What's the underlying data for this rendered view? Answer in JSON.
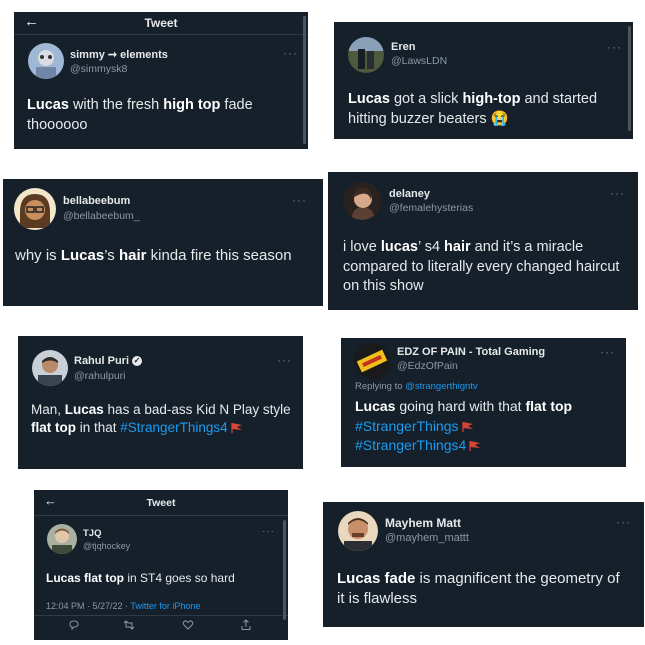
{
  "tweets": [
    {
      "header_title": "Tweet",
      "name": "simmy ➞ elements",
      "handle": "@simmysk8",
      "text": [
        [
          "Lucas",
          "hl"
        ],
        [
          " with the fresh ",
          ""
        ],
        [
          "high top",
          "hl"
        ],
        [
          " fade thoooooo",
          ""
        ]
      ]
    },
    {
      "name": "Eren",
      "handle": "@LawsLDN",
      "text": [
        [
          "Lucas",
          "hl"
        ],
        [
          " got a slick ",
          ""
        ],
        [
          "high-top",
          "hl"
        ],
        [
          " and started hitting buzzer beaters 😭",
          ""
        ]
      ]
    },
    {
      "name": "bellabeebum",
      "handle": "@bellabeebum_",
      "text": [
        [
          "why is ",
          ""
        ],
        [
          "Lucas",
          "hl"
        ],
        [
          "’s ",
          ""
        ],
        [
          "hair",
          "hl"
        ],
        [
          " kinda fire this season",
          ""
        ]
      ]
    },
    {
      "name": "delaney",
      "handle": "@femalehysterias",
      "text": [
        [
          "i love ",
          ""
        ],
        [
          "lucas",
          "hl"
        ],
        [
          "’ s4 ",
          ""
        ],
        [
          "hair",
          "hl"
        ],
        [
          " and it’s a miracle compared to literally every changed haircut on this show",
          ""
        ]
      ]
    },
    {
      "name": "Rahul Puri",
      "handle": "@rahulpuri",
      "text": [
        [
          "Man, ",
          ""
        ],
        [
          "Lucas",
          "hl"
        ],
        [
          " has a bad-ass Kid N Play style ",
          ""
        ],
        [
          "flat top",
          "hl"
        ],
        [
          " in that ",
          ""
        ],
        [
          "#StrangerThings4",
          "tag"
        ]
      ]
    },
    {
      "name": "EDZ OF PAIN - Total Gaming",
      "handle": "@EdzOfPain",
      "reply_prefix": "Replying to ",
      "reply_to": "@strangerthigntv",
      "text": [
        [
          "Lucas",
          "hl"
        ],
        [
          " going hard with that ",
          ""
        ],
        [
          "flat top",
          "hl"
        ],
        [
          "\n",
          ""
        ],
        [
          "#StrangerThings",
          "tag"
        ],
        [
          "\n",
          ""
        ],
        [
          "#StrangerThings4",
          "tag"
        ]
      ]
    },
    {
      "header_title": "Tweet",
      "name": "TJQ",
      "handle": "@tjqhockey",
      "text": [
        [
          "Lucas flat top",
          "hl"
        ],
        [
          " in ST4 goes so hard",
          ""
        ]
      ],
      "timestamp": "12:04 PM · 5/27/22 · ",
      "source": "Twitter for iPhone"
    },
    {
      "name": "Mayhem Matt",
      "handle": "@mayhem_mattt",
      "text": [
        [
          "Lucas fade",
          "hl"
        ],
        [
          " is magnificent the geometry of it is flawless",
          ""
        ]
      ]
    }
  ],
  "more_label": "···",
  "back_arrow": "←",
  "icons": {
    "reply": "reply-icon",
    "retweet": "retweet-icon",
    "like": "like-icon",
    "share": "share-icon"
  },
  "colors": {
    "background": "#15202b",
    "link": "#1d9bf0",
    "muted": "#8b98a5"
  }
}
